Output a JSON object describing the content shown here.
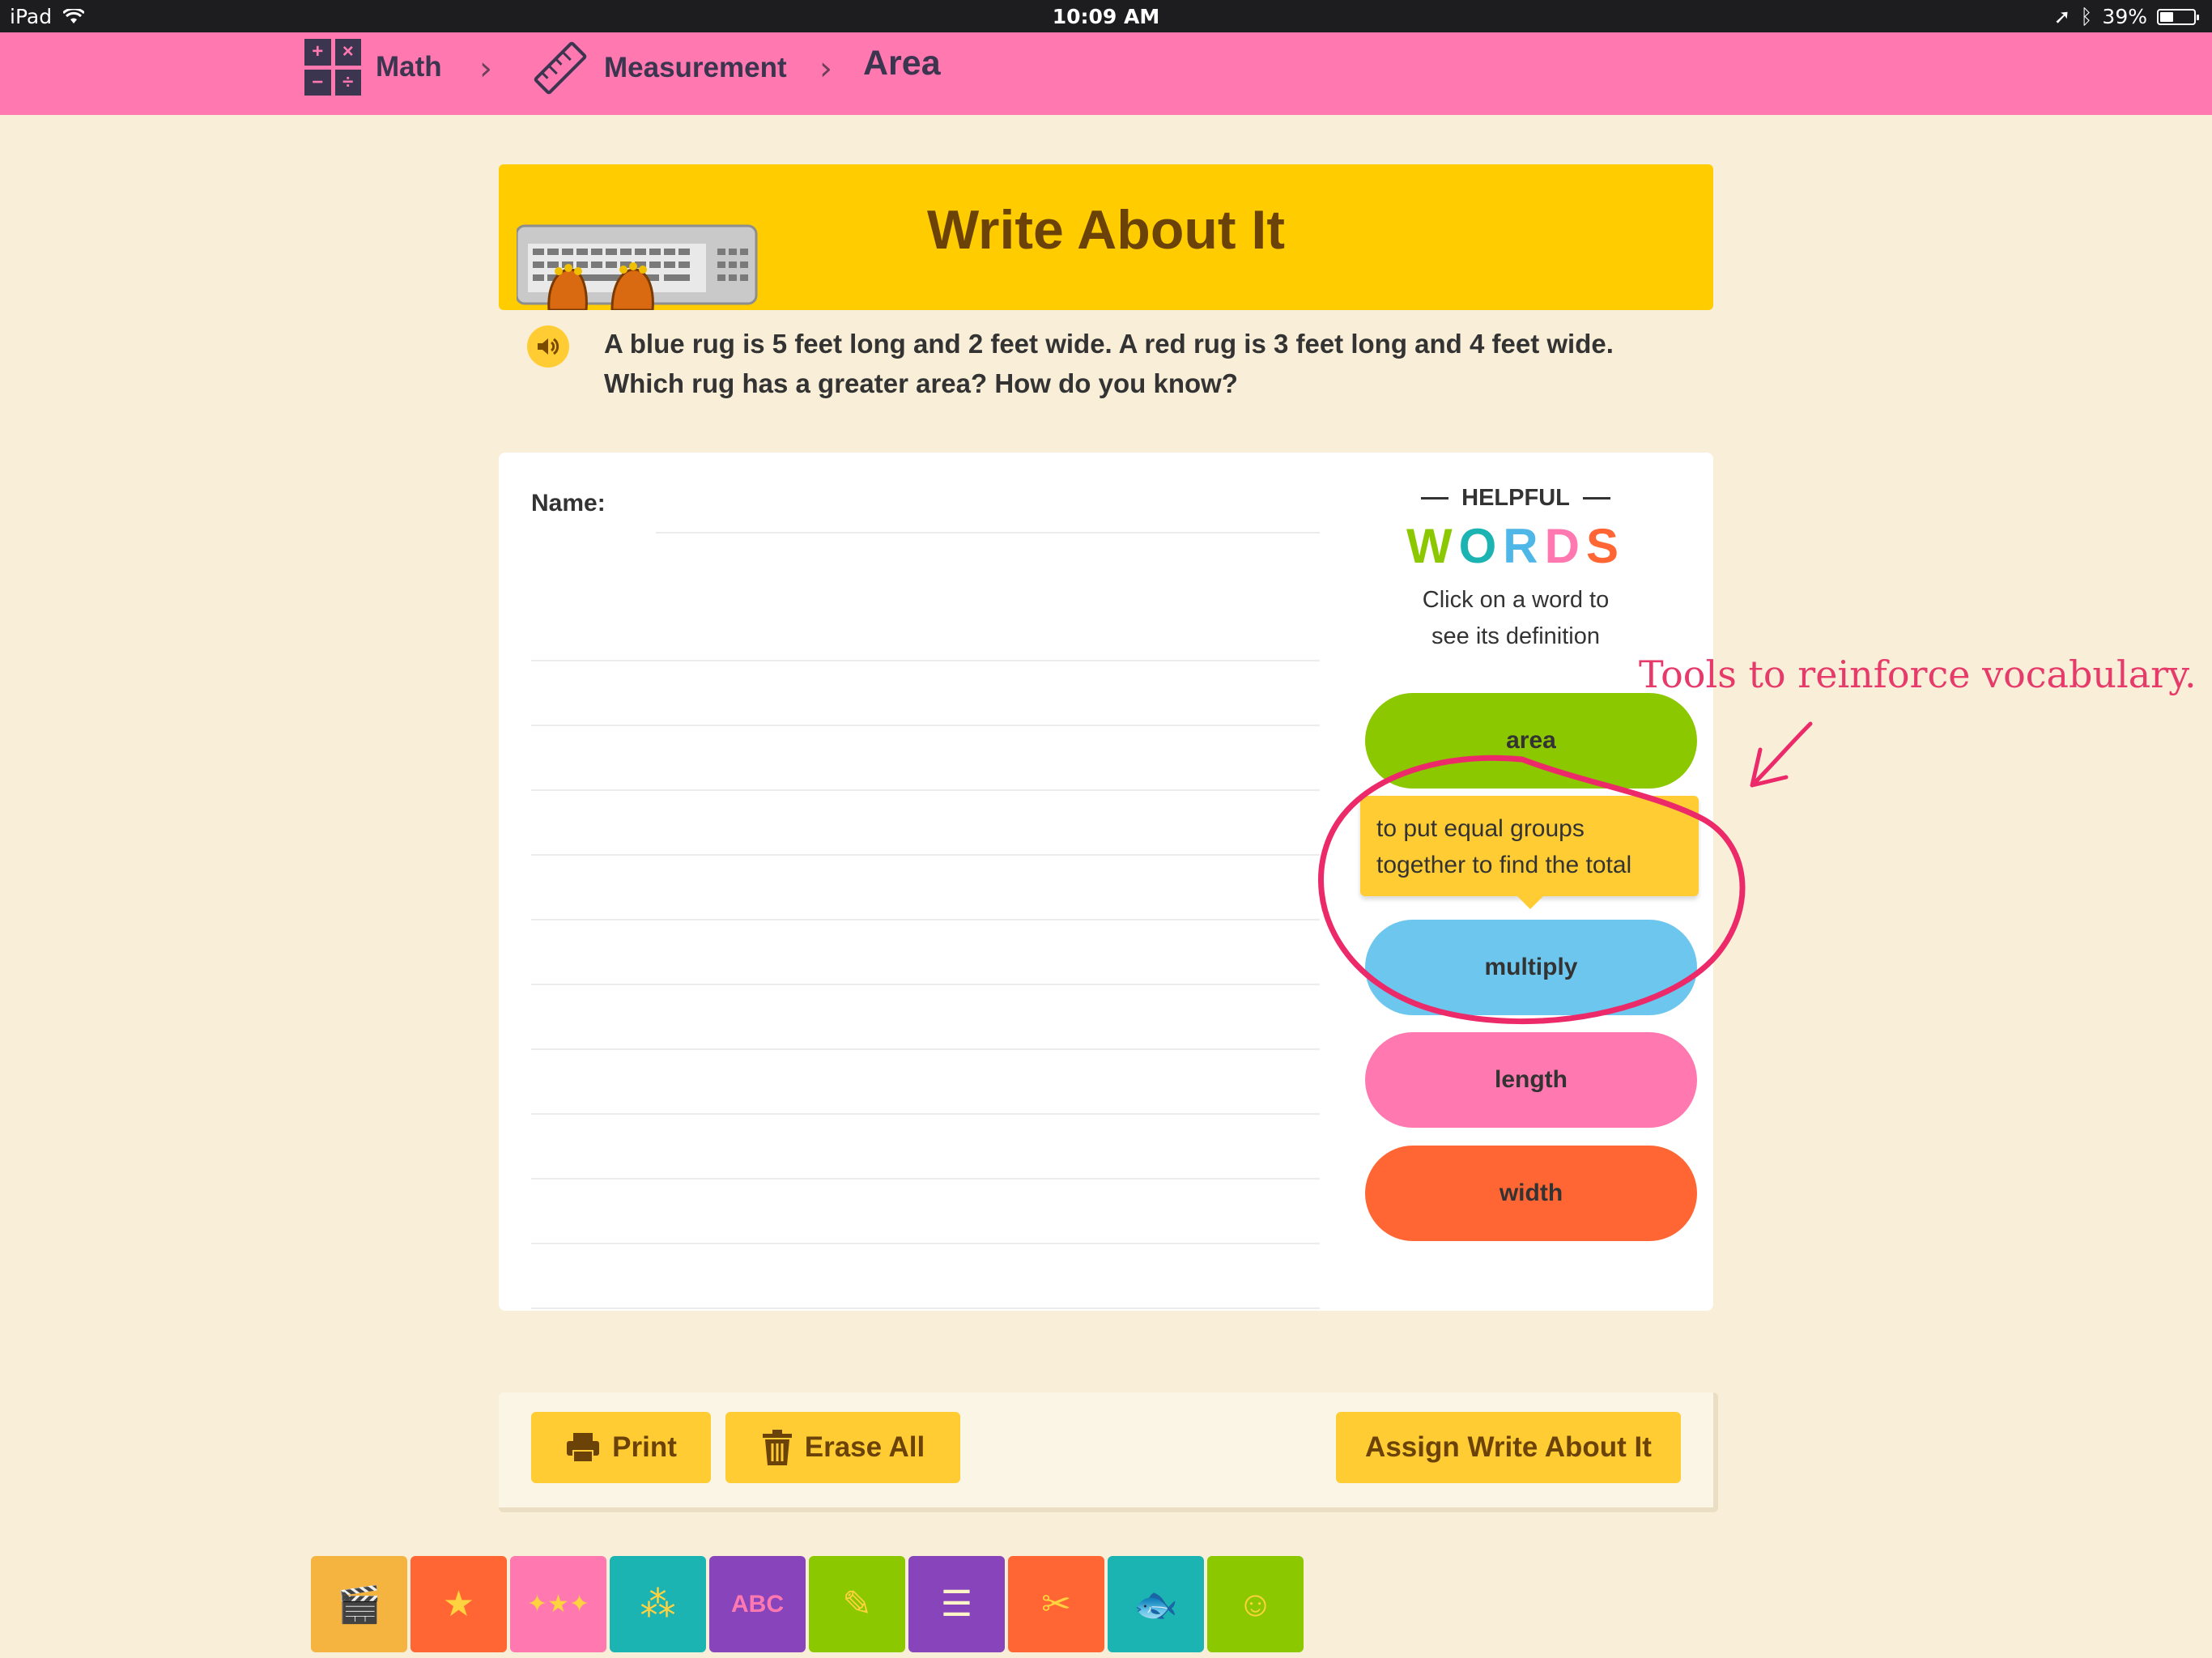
{
  "status_bar": {
    "device": "iPad",
    "time": "10:09 AM",
    "battery": "39%",
    "battery_level": 0.39
  },
  "nav": {
    "crumbs": [
      {
        "label": "Math",
        "icon": "math-operations-icon"
      },
      {
        "label": "Measurement",
        "icon": "ruler-icon"
      },
      {
        "label": "Area"
      }
    ],
    "separator": "›",
    "math_icon_glyphs": [
      "+",
      "×",
      "−",
      "÷"
    ]
  },
  "header": {
    "title": "Write About It"
  },
  "question": {
    "text": "A blue rug is 5 feet long and 2 feet wide. A red rug is 3 feet long and 4 feet wide. Which rug has a greater area? How do you know?"
  },
  "worksheet": {
    "name_label": "Name:"
  },
  "helpful_words": {
    "heading": "HELPFUL",
    "title_letters": [
      {
        "ch": "W",
        "color": "#8cc800"
      },
      {
        "ch": "O",
        "color": "#1cb3b3"
      },
      {
        "ch": "R",
        "color": "#4fb7e8"
      },
      {
        "ch": "D",
        "color": "#ff78b0"
      },
      {
        "ch": "S",
        "color": "#ff6633"
      }
    ],
    "subtitle_line1": "Click on a word to",
    "subtitle_line2": "see its definition",
    "words": [
      {
        "label": "area",
        "color": "#8cc800"
      },
      {
        "label": "multiply",
        "color": "#6dc6ee"
      },
      {
        "label": "length",
        "color": "#ff78b0"
      },
      {
        "label": "width",
        "color": "#ff6633"
      }
    ],
    "definition_line1": "to put equal groups",
    "definition_line2": "together to find the total"
  },
  "actions": {
    "print": "Print",
    "erase_all": "Erase All",
    "assign": "Assign Write About It"
  },
  "tiles": [
    {
      "icon": "clapperboard-icon",
      "glyph": "🎬",
      "color": "#f5b340"
    },
    {
      "icon": "star-icon",
      "glyph": "★",
      "color": "#ff6633"
    },
    {
      "icon": "stars-icon",
      "glyph": "✦★✦",
      "color": "#ff78b0"
    },
    {
      "icon": "network-icon",
      "glyph": "⁂",
      "color": "#1cb3b3"
    },
    {
      "icon": "abc-icon",
      "glyph": "ABC",
      "color": "#8844bb"
    },
    {
      "icon": "pencil-icon",
      "glyph": "✎",
      "color": "#8cc800"
    },
    {
      "icon": "notepad-icon",
      "glyph": "☰",
      "color": "#8844bb"
    },
    {
      "icon": "scissors-icon",
      "glyph": "✂",
      "color": "#ff6633"
    },
    {
      "icon": "fish-icon",
      "glyph": "🐟",
      "color": "#1cb3b3"
    },
    {
      "icon": "smiley-icon",
      "glyph": "☺",
      "color": "#8cc800"
    }
  ],
  "annotation": {
    "text": "Tools to reinforce vocabulary.",
    "color": "#e63a6a"
  }
}
